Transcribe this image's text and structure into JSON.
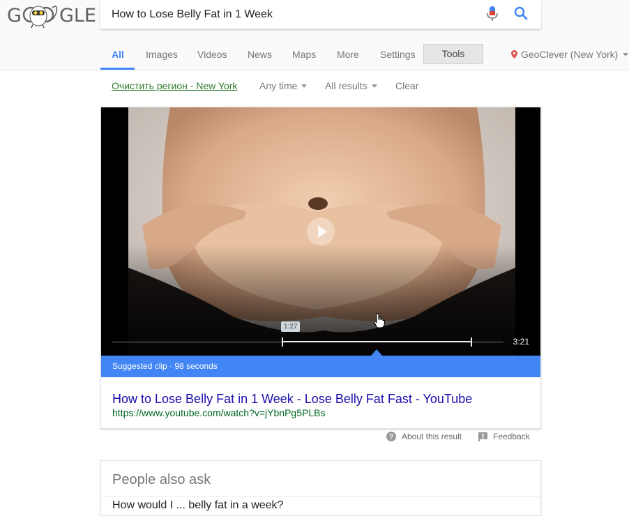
{
  "logo": {
    "text_left": "G",
    "text_right": "GLE"
  },
  "search": {
    "query": "How to Lose Belly Fat in 1 Week"
  },
  "tabs": [
    {
      "label": "All",
      "active": true
    },
    {
      "label": "Images"
    },
    {
      "label": "Videos"
    },
    {
      "label": "News"
    },
    {
      "label": "Maps"
    },
    {
      "label": "More"
    },
    {
      "label": "Settings"
    }
  ],
  "tools_label": "Tools",
  "geo_label": "GeoClever (New York)",
  "filters": {
    "region": "Очистить регион - New York",
    "time": "Any time",
    "results": "All results",
    "clear": "Clear"
  },
  "video": {
    "tooltip_time": "1:27",
    "duration": "3:21",
    "suggested_clip": "Suggested clip · 98 seconds"
  },
  "result": {
    "title_part1": "How to Lose Belly Fat in 1 Week",
    "sep1": " - ",
    "title_part2": "Lose Belly Fat Fast",
    "sep2": " - ",
    "title_part3": "YouTube",
    "url": "https://www.youtube.com/watch?v=jYbnPg5PLBs"
  },
  "meta": {
    "about": "About this result",
    "feedback": "Feedback"
  },
  "people_also_ask": {
    "title": "People also ask",
    "first_question": "How would I ... belly fat in a week?"
  },
  "colors": {
    "accent": "#4285f4",
    "link": "#1a0dab",
    "url": "#006621"
  }
}
